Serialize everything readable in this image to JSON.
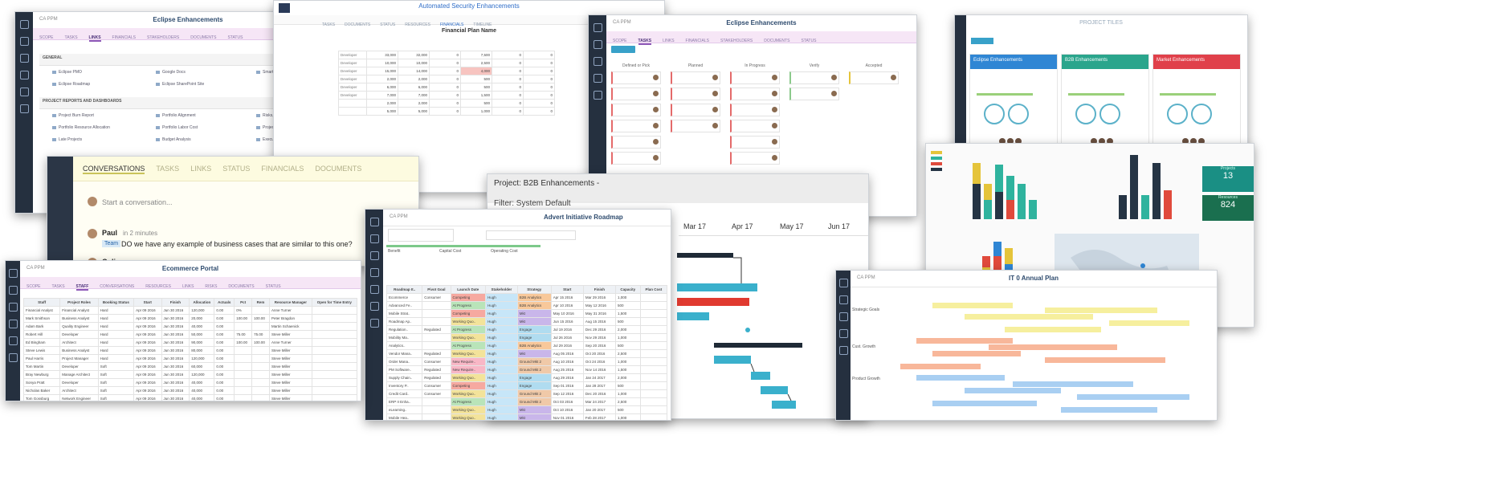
{
  "s1": {
    "title": "Eclipse Enhancements",
    "tabs": [
      "SCOPE",
      "TASKS",
      "LINKS",
      "FINANCIALS",
      "STAKEHOLDERS",
      "DOCUMENTS",
      "STATUS"
    ],
    "active_tab": 2,
    "sections": [
      {
        "title": "GENERAL",
        "links": [
          "Eclipse PMO",
          "Google Docs",
          "Smartsheet",
          "Eclipse Roadmap",
          "Eclipse SharePoint Site",
          ""
        ]
      },
      {
        "title": "PROJECT REPORTS AND DASHBOARDS",
        "links": [
          "Project Burn Report",
          "Portfolio Alignment",
          "Risks, Issues and Changes",
          "Portfolio Resource Allocation",
          "Portfolio Labor Cost",
          "Project Plan Changes",
          "Late Projects",
          "Budget Analysis",
          "Executive Dashboard"
        ]
      }
    ]
  },
  "s2": {
    "header_tabs": [
      "TASKS",
      "DOCUMENTS",
      "STATUS",
      "RESOURCES",
      "FINANCIALS",
      "TIMELINE"
    ],
    "project_title": "Automated Security Enhancements",
    "sheet_title": "Financial Plan Name",
    "rows": [
      [
        "33,000",
        "32,000",
        "0",
        "7,500",
        "0",
        "0"
      ],
      [
        "10,000",
        "10,000",
        "0",
        "2,500",
        "0",
        "0"
      ],
      [
        "15,000",
        "14,000",
        "0",
        "4,000",
        "0",
        "0"
      ],
      [
        "2,000",
        "2,000",
        "0",
        "500",
        "0",
        "0"
      ],
      [
        "6,000",
        "6,000",
        "0",
        "500",
        "0",
        "0"
      ],
      [
        "7,000",
        "7,000",
        "0",
        "1,500",
        "0",
        "0"
      ],
      [
        "2,000",
        "2,000",
        "0",
        "500",
        "0",
        "0"
      ],
      [
        "5,000",
        "5,000",
        "0",
        "1,000",
        "0",
        "0"
      ]
    ],
    "row_labels": [
      "Developer",
      "Developer",
      "Developer",
      "Developer",
      "Developer",
      "Developer"
    ]
  },
  "s3": {
    "title": "Eclipse Enhancements",
    "tabs": [
      "SCOPE",
      "TASKS",
      "LINKS",
      "FINANCIALS",
      "STAKEHOLDERS",
      "DOCUMENTS",
      "STATUS"
    ],
    "columns": [
      "Defined or Pick",
      "Planned",
      "In Progress",
      "Verify",
      "Accepted"
    ]
  },
  "s4": {
    "title": "PROJECT TILES",
    "tiles": [
      {
        "name": "Eclipse Enhancements",
        "color": "#2f86d4"
      },
      {
        "name": "B2B Enhancements",
        "color": "#2aa58c"
      },
      {
        "name": "Market Enhancements",
        "color": "#e0404a"
      }
    ]
  },
  "s5": {
    "tabs": [
      "CONVERSATIONS",
      "TASKS",
      "LINKS",
      "STATUS",
      "FINANCIALS",
      "DOCUMENTS"
    ],
    "placeholder": "Start a conversation...",
    "author": "Paul",
    "time": "in 2 minutes",
    "tag": "Team",
    "message": "DO we have any example of business cases that are similar to this one?",
    "second_author": "Colin"
  },
  "s6": {
    "project": "Project: B2B Enhancements -",
    "filter": "Filter: System Default",
    "months": [
      "Mar 17",
      "Apr 17",
      "May 17",
      "Jun 17"
    ]
  },
  "s7": {
    "title": "Advert Initiative Roadmap",
    "cards": [
      "Benefit",
      "Capital Cost",
      "Operating Cost"
    ],
    "headers": [
      "Roadmap It..",
      "Pivot Goal",
      "Launch Date",
      "Stakeholder",
      "Strategy",
      "Start",
      "Finish",
      "Capacity",
      "Plan Cost"
    ],
    "rows": [
      [
        "Ecommerce",
        "Consumer",
        "Competing",
        "Hugh",
        "B2B Analytics",
        "Apr 15 2016",
        "Mar 29 2016",
        "1,000"
      ],
      [
        "Advanced Fe..",
        "",
        "At Progress",
        "Hugh",
        "B2B Analytics",
        "Apr 10 2016",
        "May 12 2016",
        "500"
      ],
      [
        "Mobile Strat..",
        "",
        "Competing",
        "Hugh",
        "Mkt",
        "May 10 2016",
        "May 31 2016",
        "1,500"
      ],
      [
        "Roadmap Ap..",
        "",
        "Working Quo..",
        "Hugh",
        "Mkt",
        "Jun 15 2016",
        "Aug 15 2016",
        "500"
      ],
      [
        "Regulation..",
        "Regulated",
        "At Progress",
        "Hugh",
        "Engage",
        "Jul 19 2016",
        "Dec 29 2016",
        "2,000"
      ],
      [
        "Mobility Ma..",
        "",
        "Working Quo..",
        "Hugh",
        "Engage",
        "Jul 26 2016",
        "Nov 29 2016",
        "1,000"
      ],
      [
        "Analytics..",
        "",
        "At Progress",
        "Hugh",
        "B2B Analytics",
        "Jul 29 2016",
        "Sep 20 2016",
        "500"
      ],
      [
        "Vendor Mana..",
        "Regulated",
        "Working Quo..",
        "Hugh",
        "Mkt",
        "Aug 05 2016",
        "Oct 20 2016",
        "2,500"
      ],
      [
        "Order Mana..",
        "Consumer",
        "New Require..",
        "Hugh",
        "Ground Mkt 2",
        "Aug 10 2016",
        "Oct 24 2016",
        "1,000"
      ],
      [
        "PM Software..",
        "Regulated",
        "New Require..",
        "Hugh",
        "Ground Mkt 2",
        "Aug 25 2016",
        "Nov 14 2016",
        "1,500"
      ],
      [
        "Supply Chain..",
        "Regulated",
        "Working Quo..",
        "Hugh",
        "Engage",
        "Aug 29 2016",
        "Jan 24 2017",
        "2,000"
      ],
      [
        "Inventory P..",
        "Consumer",
        "Competing",
        "Hugh",
        "Engage",
        "Sep 01 2016",
        "Jan 28 2017",
        "500"
      ],
      [
        "Credit Card..",
        "Consumer",
        "Working Quo..",
        "Hugh",
        "Ground Mkt 2",
        "Sep 12 2016",
        "Dec 20 2016",
        "1,000"
      ],
      [
        "ERP II Enha..",
        "",
        "At Progress",
        "Hugh",
        "Ground Mkt 2",
        "Oct 03 2016",
        "Mar 24 2017",
        "2,500"
      ],
      [
        "eLearning..",
        "",
        "Working Quo..",
        "Hugh",
        "Mkt",
        "Oct 10 2016",
        "Jan 20 2017",
        "500"
      ],
      [
        "Mobile Hea..",
        "",
        "Working Quo..",
        "Hugh",
        "Mkt",
        "Nov 01 2016",
        "Feb 28 2017",
        "1,000"
      ],
      [
        "Mobility Fun..",
        "Consumer",
        "Competing",
        "Hugh",
        "Engage",
        "Nov 15 2016",
        "Jul 21 2017",
        "500"
      ],
      [
        "Mobile Cust..",
        "",
        "New Require..",
        "Hugh",
        "Engage",
        "Dec 01 2016",
        "Jun 01 2017",
        "1,500"
      ]
    ]
  },
  "s8": {
    "tiles": [
      {
        "label": "Projects",
        "value": "13"
      },
      {
        "label": "Resources",
        "value": "824"
      }
    ]
  },
  "s9": {
    "title": "Ecommerce Portal",
    "tabs": [
      "SCOPE",
      "TASKS",
      "STAFF",
      "CONVERSATIONS",
      "RESOURCES",
      "LINKS",
      "RISKS",
      "DOCUMENTS",
      "STATUS"
    ],
    "headers": [
      "Staff",
      "Project Roles",
      "Booking Status",
      "Start",
      "Finish",
      "Allocation",
      "Actuals",
      "Pct",
      "Rem",
      "Resource Manager",
      "Open for Time Entry"
    ],
    "rows": [
      [
        "Financial Analyst",
        "Financial Analyst",
        "Hard",
        "Apr 09 2016",
        "Jun 30 2016",
        "120,000",
        "0.00",
        "0%",
        "",
        "Anne Turner",
        ""
      ],
      [
        "Mark Smithson",
        "Business Analyst",
        "Hard",
        "Apr 09 2016",
        "Jun 30 2016",
        "20,000",
        "0.00",
        "100.00",
        "100.00",
        "Peter Bragdon",
        ""
      ],
      [
        "Adam Bark",
        "Quality Engineer",
        "Hard",
        "Apr 09 2016",
        "Jun 30 2016",
        "40,000",
        "0.00",
        "",
        "",
        "Martin Schaenick",
        ""
      ],
      [
        "Robert Hill",
        "Developer",
        "Hard",
        "Apr 09 2016",
        "Jun 30 2016",
        "50,000",
        "0.00",
        "75.00",
        "75.00",
        "Steve Miller",
        ""
      ],
      [
        "Ed Bingham",
        "Architect",
        "Hard",
        "Apr 09 2016",
        "Jun 30 2016",
        "90,000",
        "0.00",
        "100.00",
        "100.00",
        "Anne Turner",
        ""
      ],
      [
        "Steve Lewis",
        "Business Analyst",
        "Hard",
        "Apr 09 2016",
        "Jun 30 2016",
        "80,000",
        "0.00",
        "",
        "",
        "Steve Miller",
        ""
      ],
      [
        "Paul Harris",
        "Project Manager",
        "Hard",
        "Apr 09 2016",
        "Jun 30 2016",
        "120,000",
        "0.00",
        "",
        "",
        "Steve Miller",
        ""
      ],
      [
        "Tom Martin",
        "Developer",
        "Soft",
        "Apr 09 2016",
        "Jun 30 2016",
        "60,000",
        "0.00",
        "",
        "",
        "Steve Miller",
        ""
      ],
      [
        "Bray Newburg",
        "Manage Architect",
        "Soft",
        "Apr 09 2016",
        "Jun 30 2016",
        "120,000",
        "0.00",
        "",
        "",
        "Steve Miller",
        ""
      ],
      [
        "Sonya Pratt",
        "Developer",
        "Soft",
        "Apr 09 2016",
        "Jun 30 2016",
        "40,000",
        "0.00",
        "",
        "",
        "Steve Miller",
        ""
      ],
      [
        "Nicholas Baker",
        "Architect",
        "Soft",
        "Apr 09 2016",
        "Jun 30 2016",
        "40,000",
        "0.00",
        "",
        "",
        "Steve Miller",
        ""
      ],
      [
        "Tom Gossburg",
        "Network Engineer",
        "Soft",
        "Apr 09 2016",
        "Jun 30 2016",
        "40,000",
        "0.00",
        "",
        "",
        "Steve Miller",
        ""
      ],
      [
        "Brady Claire",
        "Architect",
        "Soft",
        "Apr 09 2016",
        "Jun 30 2016",
        "40,000",
        "0.00",
        "",
        "",
        "Steve Miller",
        ""
      ]
    ]
  },
  "s10": {
    "title": "IT 0 Annual Plan",
    "groups": [
      "Strategic Goals",
      "Cust. Growth",
      "Product Growth"
    ]
  }
}
